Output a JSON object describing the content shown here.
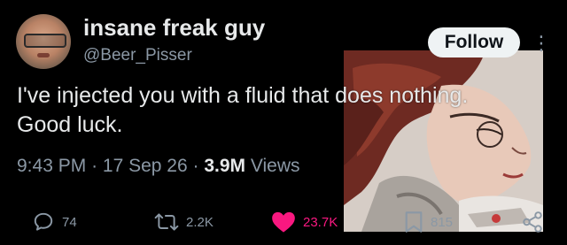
{
  "author": {
    "display_name": "insane freak guy",
    "handle": "@Beer_Pisser"
  },
  "follow_button": {
    "label": "Follow"
  },
  "more_icon": "more-dots-icon",
  "tweet": {
    "text": "I've injected you with a fluid that does nothing.\nGood luck."
  },
  "meta": {
    "time": "9:43 PM",
    "separator": "·",
    "date": "17 Sep 26",
    "views_count": "3.9M",
    "views_label": "Views"
  },
  "actions": {
    "replies": {
      "icon": "reply-icon",
      "count": "74"
    },
    "retweets": {
      "icon": "retweet-icon",
      "count": "2.2K"
    },
    "likes": {
      "icon": "heart-icon",
      "count": "23.7K"
    },
    "bookmarks": {
      "icon": "bookmark-icon",
      "count": "815"
    },
    "share": {
      "icon": "share-icon"
    }
  },
  "colors": {
    "background": "#000000",
    "text": "#e7e9ea",
    "muted": "#8b98a5",
    "like": "#f91880",
    "follow_bg": "#eff3f4"
  }
}
